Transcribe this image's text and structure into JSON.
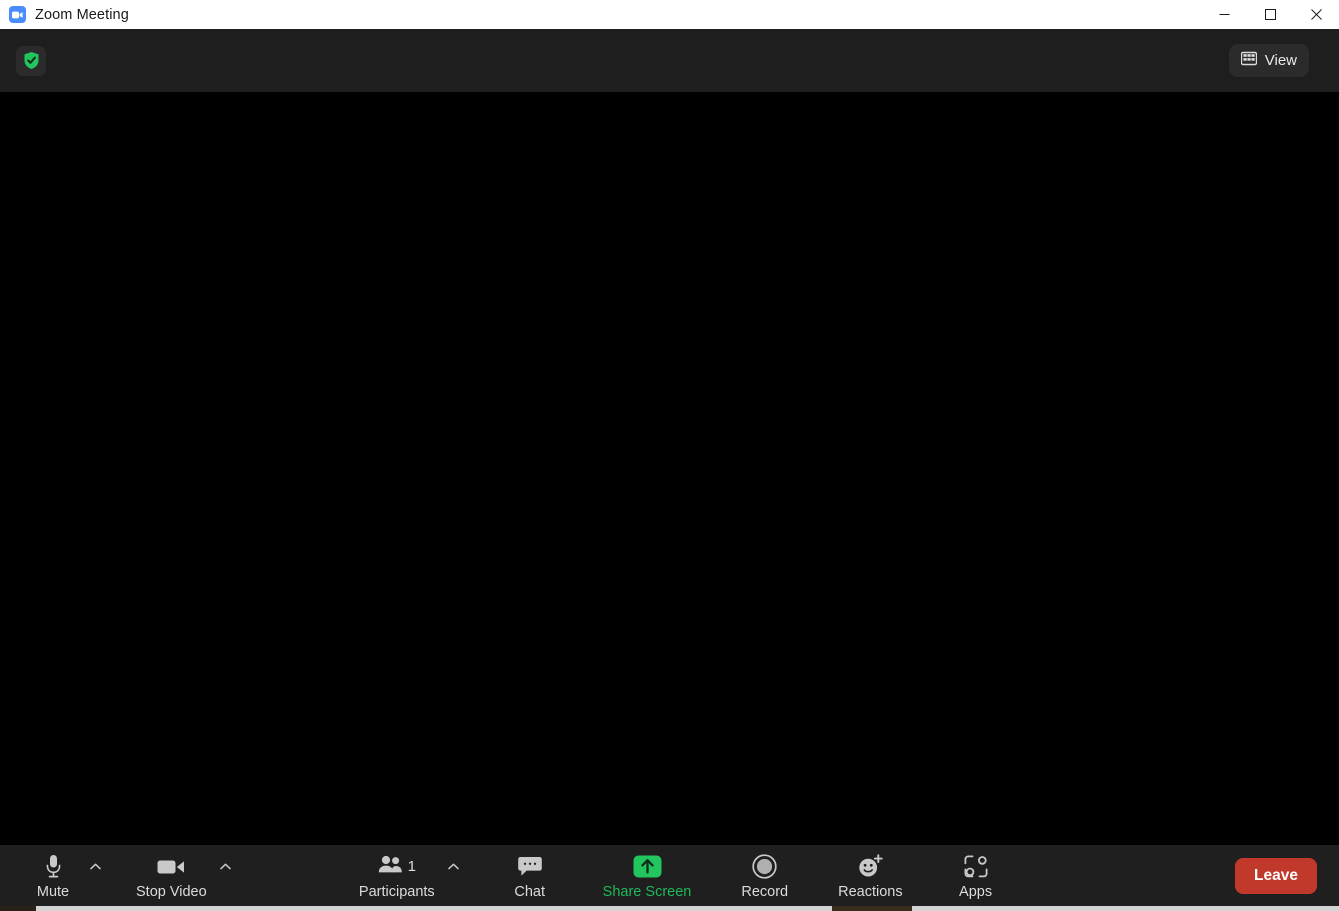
{
  "window": {
    "title": "Zoom Meeting",
    "logo_icon": "zoom-camera-icon",
    "controls": {
      "minimize": "minimize-icon",
      "maximize": "maximize-icon",
      "close": "close-icon"
    }
  },
  "header": {
    "security_icon": "shield-check-icon",
    "view_button": {
      "label": "View",
      "icon": "gallery-grid-icon"
    }
  },
  "stage": {
    "background": "#000000"
  },
  "toolbar": {
    "left": [
      {
        "key": "mute",
        "label": "Mute",
        "icon": "microphone-icon",
        "has_caret": true,
        "caret_icon": "chevron-up-icon"
      },
      {
        "key": "stop_video",
        "label": "Stop Video",
        "icon": "video-camera-icon",
        "has_caret": true,
        "caret_icon": "chevron-up-icon"
      }
    ],
    "center": [
      {
        "key": "participants",
        "label": "Participants",
        "icon": "people-icon",
        "count": "1",
        "has_caret": true,
        "caret_icon": "chevron-up-icon"
      },
      {
        "key": "chat",
        "label": "Chat",
        "icon": "speech-bubble-icon",
        "has_caret": false
      },
      {
        "key": "share_screen",
        "label": "Share Screen",
        "icon": "share-arrow-up-icon",
        "accent": "#22c55e",
        "has_caret": false
      },
      {
        "key": "record",
        "label": "Record",
        "icon": "record-circle-icon",
        "has_caret": false
      },
      {
        "key": "reactions",
        "label": "Reactions",
        "icon": "smiley-plus-icon",
        "has_caret": false
      },
      {
        "key": "apps",
        "label": "Apps",
        "icon": "apps-bracket-icon",
        "has_caret": false
      }
    ],
    "leave_label": "Leave",
    "colors": {
      "toolbar_bg": "#1f1f1f",
      "leave_red": "#c0392b",
      "share_green": "#1eb95a",
      "shield_green": "#22c55e",
      "zoom_blue": "#4a8cff"
    }
  }
}
